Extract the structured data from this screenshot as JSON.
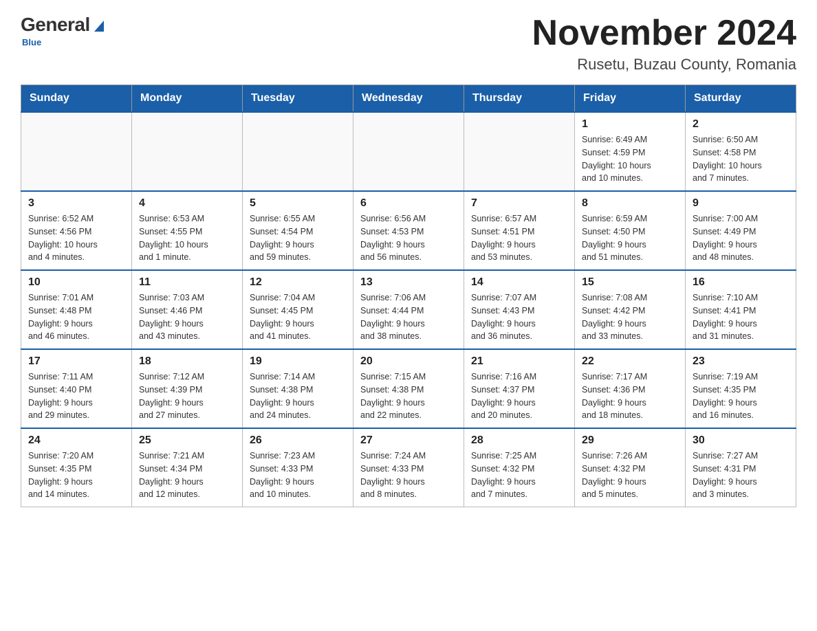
{
  "logo": {
    "general": "General",
    "blue": "Blue",
    "subtitle": "Blue"
  },
  "header": {
    "title": "November 2024",
    "location": "Rusetu, Buzau County, Romania"
  },
  "days_of_week": [
    "Sunday",
    "Monday",
    "Tuesday",
    "Wednesday",
    "Thursday",
    "Friday",
    "Saturday"
  ],
  "weeks": [
    [
      {
        "day": "",
        "info": ""
      },
      {
        "day": "",
        "info": ""
      },
      {
        "day": "",
        "info": ""
      },
      {
        "day": "",
        "info": ""
      },
      {
        "day": "",
        "info": ""
      },
      {
        "day": "1",
        "info": "Sunrise: 6:49 AM\nSunset: 4:59 PM\nDaylight: 10 hours\nand 10 minutes."
      },
      {
        "day": "2",
        "info": "Sunrise: 6:50 AM\nSunset: 4:58 PM\nDaylight: 10 hours\nand 7 minutes."
      }
    ],
    [
      {
        "day": "3",
        "info": "Sunrise: 6:52 AM\nSunset: 4:56 PM\nDaylight: 10 hours\nand 4 minutes."
      },
      {
        "day": "4",
        "info": "Sunrise: 6:53 AM\nSunset: 4:55 PM\nDaylight: 10 hours\nand 1 minute."
      },
      {
        "day": "5",
        "info": "Sunrise: 6:55 AM\nSunset: 4:54 PM\nDaylight: 9 hours\nand 59 minutes."
      },
      {
        "day": "6",
        "info": "Sunrise: 6:56 AM\nSunset: 4:53 PM\nDaylight: 9 hours\nand 56 minutes."
      },
      {
        "day": "7",
        "info": "Sunrise: 6:57 AM\nSunset: 4:51 PM\nDaylight: 9 hours\nand 53 minutes."
      },
      {
        "day": "8",
        "info": "Sunrise: 6:59 AM\nSunset: 4:50 PM\nDaylight: 9 hours\nand 51 minutes."
      },
      {
        "day": "9",
        "info": "Sunrise: 7:00 AM\nSunset: 4:49 PM\nDaylight: 9 hours\nand 48 minutes."
      }
    ],
    [
      {
        "day": "10",
        "info": "Sunrise: 7:01 AM\nSunset: 4:48 PM\nDaylight: 9 hours\nand 46 minutes."
      },
      {
        "day": "11",
        "info": "Sunrise: 7:03 AM\nSunset: 4:46 PM\nDaylight: 9 hours\nand 43 minutes."
      },
      {
        "day": "12",
        "info": "Sunrise: 7:04 AM\nSunset: 4:45 PM\nDaylight: 9 hours\nand 41 minutes."
      },
      {
        "day": "13",
        "info": "Sunrise: 7:06 AM\nSunset: 4:44 PM\nDaylight: 9 hours\nand 38 minutes."
      },
      {
        "day": "14",
        "info": "Sunrise: 7:07 AM\nSunset: 4:43 PM\nDaylight: 9 hours\nand 36 minutes."
      },
      {
        "day": "15",
        "info": "Sunrise: 7:08 AM\nSunset: 4:42 PM\nDaylight: 9 hours\nand 33 minutes."
      },
      {
        "day": "16",
        "info": "Sunrise: 7:10 AM\nSunset: 4:41 PM\nDaylight: 9 hours\nand 31 minutes."
      }
    ],
    [
      {
        "day": "17",
        "info": "Sunrise: 7:11 AM\nSunset: 4:40 PM\nDaylight: 9 hours\nand 29 minutes."
      },
      {
        "day": "18",
        "info": "Sunrise: 7:12 AM\nSunset: 4:39 PM\nDaylight: 9 hours\nand 27 minutes."
      },
      {
        "day": "19",
        "info": "Sunrise: 7:14 AM\nSunset: 4:38 PM\nDaylight: 9 hours\nand 24 minutes."
      },
      {
        "day": "20",
        "info": "Sunrise: 7:15 AM\nSunset: 4:38 PM\nDaylight: 9 hours\nand 22 minutes."
      },
      {
        "day": "21",
        "info": "Sunrise: 7:16 AM\nSunset: 4:37 PM\nDaylight: 9 hours\nand 20 minutes."
      },
      {
        "day": "22",
        "info": "Sunrise: 7:17 AM\nSunset: 4:36 PM\nDaylight: 9 hours\nand 18 minutes."
      },
      {
        "day": "23",
        "info": "Sunrise: 7:19 AM\nSunset: 4:35 PM\nDaylight: 9 hours\nand 16 minutes."
      }
    ],
    [
      {
        "day": "24",
        "info": "Sunrise: 7:20 AM\nSunset: 4:35 PM\nDaylight: 9 hours\nand 14 minutes."
      },
      {
        "day": "25",
        "info": "Sunrise: 7:21 AM\nSunset: 4:34 PM\nDaylight: 9 hours\nand 12 minutes."
      },
      {
        "day": "26",
        "info": "Sunrise: 7:23 AM\nSunset: 4:33 PM\nDaylight: 9 hours\nand 10 minutes."
      },
      {
        "day": "27",
        "info": "Sunrise: 7:24 AM\nSunset: 4:33 PM\nDaylight: 9 hours\nand 8 minutes."
      },
      {
        "day": "28",
        "info": "Sunrise: 7:25 AM\nSunset: 4:32 PM\nDaylight: 9 hours\nand 7 minutes."
      },
      {
        "day": "29",
        "info": "Sunrise: 7:26 AM\nSunset: 4:32 PM\nDaylight: 9 hours\nand 5 minutes."
      },
      {
        "day": "30",
        "info": "Sunrise: 7:27 AM\nSunset: 4:31 PM\nDaylight: 9 hours\nand 3 minutes."
      }
    ]
  ]
}
